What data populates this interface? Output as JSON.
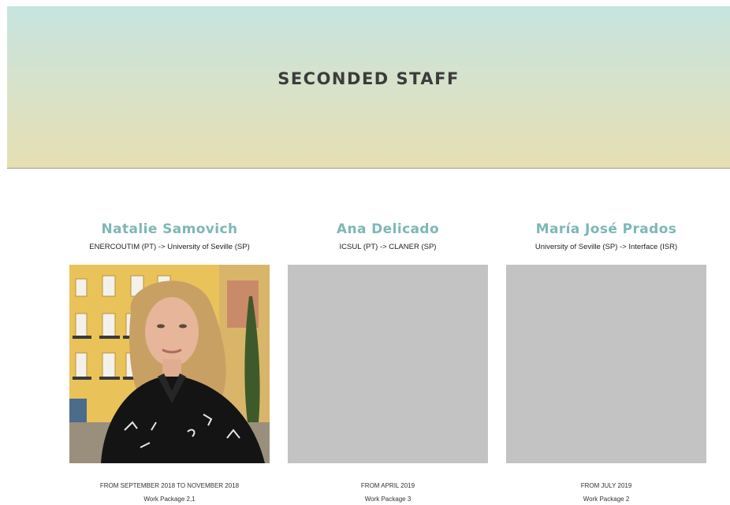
{
  "header": {
    "title": "SECONDED STAFF"
  },
  "staff": [
    {
      "name": "Natalie Samovich",
      "route": "ENERCOUTIM (PT) -> University of Seville (SP)",
      "dates": "FROM SEPTEMBER 2018 TO NOVEMBER 2018",
      "work_package": "Work Package 2,1",
      "has_photo": true
    },
    {
      "name": "Ana Delicado",
      "route": "ICSUL (PT) -> CLANER (SP)",
      "dates": "FROM APRIL 2019",
      "work_package": "Work Package 3",
      "has_photo": false
    },
    {
      "name": "María José Prados",
      "route": "University of Seville (SP) -> Interface (ISR)",
      "dates": "FROM JULY 2019",
      "work_package": "Work Package 2",
      "has_photo": false
    }
  ],
  "colors": {
    "accent_name": "#7cb8b6",
    "placeholder": "#c3c3c3",
    "hero_top": "#c6e4df",
    "hero_bottom": "#e6dfb3"
  }
}
